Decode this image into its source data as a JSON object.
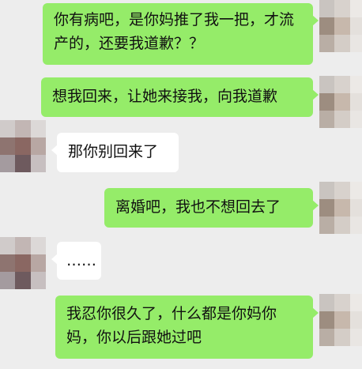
{
  "colors": {
    "background": "#ededed",
    "sent_bubble": "#95ec69",
    "received_bubble": "#ffffff",
    "text": "#111111"
  },
  "messages": [
    {
      "side": "right",
      "text": "你有病吧，是你妈推了我一把，才流产的，还要我道歉？？"
    },
    {
      "side": "right",
      "text": "想我回来，让她来接我，向我道歉"
    },
    {
      "side": "left",
      "text": "那你别回来了"
    },
    {
      "side": "right",
      "text": "离婚吧，我也不想回去了"
    },
    {
      "side": "left",
      "text": "……"
    },
    {
      "side": "right",
      "text": "我忍你很久了，什么都是你妈你妈，你以后跟她过吧"
    }
  ],
  "avatars": {
    "self": {
      "icon": "pixelated-avatar-icon",
      "palette": [
        "#c9c4c0",
        "#d8d2cd",
        "#ece9e6",
        "#9d8d80",
        "#c7b8ac",
        "#e4e0dc",
        "#b9aea5",
        "#d4cdc7",
        "#e9e6e3"
      ]
    },
    "other": {
      "icon": "pixelated-avatar-icon",
      "palette": [
        "#d0cbca",
        "#c2b6b4",
        "#dcd8d7",
        "#8e7470",
        "#8a6762",
        "#b8a7a3",
        "#a49b9f",
        "#6e5a5e",
        "#c7bfc0"
      ]
    }
  }
}
